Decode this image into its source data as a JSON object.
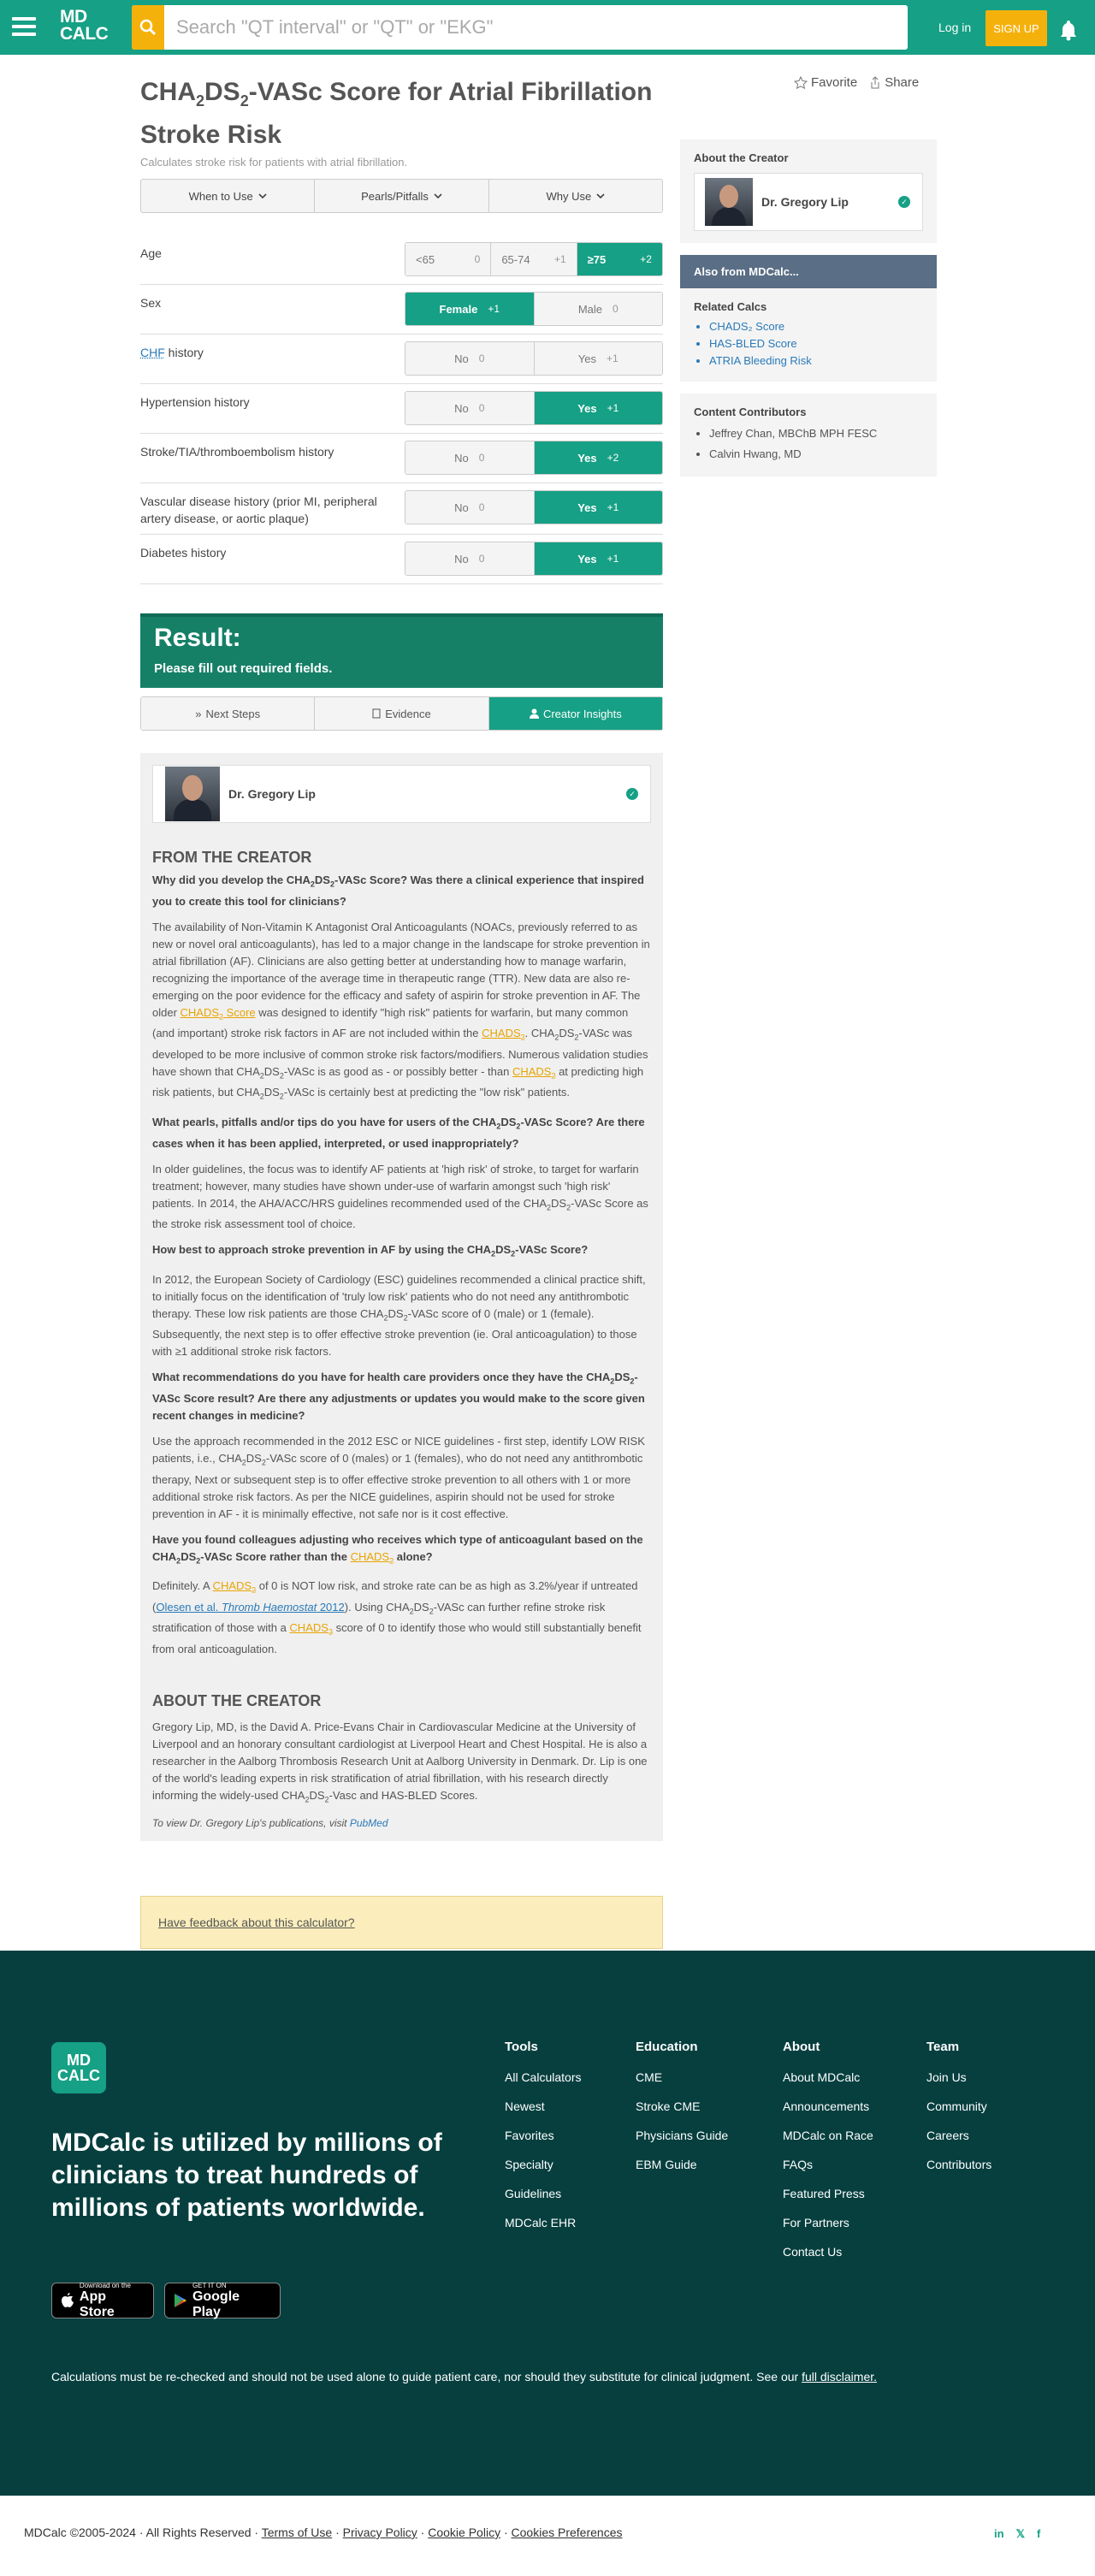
{
  "header": {
    "logo_line1": "MD",
    "logo_line2": "CALC",
    "search_placeholder": "Search \"QT interval\" or \"QT\" or \"EKG\"",
    "login": "Log in",
    "signup": "SIGN UP"
  },
  "page": {
    "title_a": "CHA",
    "title_sub1": "2",
    "title_b": "DS",
    "title_sub2": "2",
    "title_c": "-VASc Score for Atrial Fibrillation Stroke Risk",
    "subtitle": "Calculates stroke risk for patients with atrial fibrillation.",
    "favorite": "Favorite",
    "share": "Share",
    "tabs": [
      "When to Use",
      "Pearls/Pitfalls",
      "Why Use"
    ]
  },
  "inputs": [
    {
      "label": "Age",
      "options": [
        {
          "text": "<65",
          "pts": "0"
        },
        {
          "text": "65-74",
          "pts": "+1"
        },
        {
          "text": "≥75",
          "pts": "+2"
        }
      ],
      "selected": 2
    },
    {
      "label": "Sex",
      "options": [
        {
          "text": "Female",
          "pts": "+1"
        },
        {
          "text": "Male",
          "pts": "0"
        }
      ],
      "selected": 0
    },
    {
      "label_abbr": "CHF",
      "label": " history",
      "options": [
        {
          "text": "No",
          "pts": "0"
        },
        {
          "text": "Yes",
          "pts": "+1"
        }
      ],
      "selected": -1
    },
    {
      "label": "Hypertension history",
      "options": [
        {
          "text": "No",
          "pts": "0"
        },
        {
          "text": "Yes",
          "pts": "+1"
        }
      ],
      "selected": 1
    },
    {
      "label": "Stroke/TIA/thromboembolism history",
      "options": [
        {
          "text": "No",
          "pts": "0"
        },
        {
          "text": "Yes",
          "pts": "+2"
        }
      ],
      "selected": 1
    },
    {
      "label": "Vascular disease history (prior MI, peripheral artery disease, or aortic plaque)",
      "options": [
        {
          "text": "No",
          "pts": "0"
        },
        {
          "text": "Yes",
          "pts": "+1"
        }
      ],
      "selected": 1
    },
    {
      "label": "Diabetes history",
      "options": [
        {
          "text": "No",
          "pts": "0"
        },
        {
          "text": "Yes",
          "pts": "+1"
        }
      ],
      "selected": 1
    }
  ],
  "result": {
    "heading": "Result:",
    "message": "Please fill out required fields."
  },
  "subtabs": [
    "Next Steps",
    "Evidence",
    "Creator Insights"
  ],
  "creator": {
    "name": "Dr. Gregory Lip",
    "from_heading": "FROM THE CREATOR",
    "about_heading": "ABOUT THE CREATOR",
    "pubs_text": "To view Dr. Gregory Lip's publications, visit ",
    "pubs_link": "PubMed"
  },
  "feedback": "Have feedback about this calculator?",
  "sidebar": {
    "about_heading": "About the Creator",
    "creator_name": "Dr. Gregory Lip",
    "also_from": "Also from MDCalc...",
    "related_heading": "Related Calcs",
    "related": [
      "CHADS₂ Score",
      "HAS-BLED Score",
      "ATRIA Bleeding Risk"
    ],
    "contrib_heading": "Content Contributors",
    "contributors": [
      "Jeffrey Chan, MBChB MPH FESC",
      "Calvin Hwang, MD"
    ]
  },
  "footer": {
    "tagline": "MDCalc is utilized by millions of clinicians to treat hundreds of millions of patients worldwide.",
    "appstore_small": "Download on the",
    "appstore": "App Store",
    "gplay_small": "GET IT ON",
    "gplay": "Google Play",
    "cols": [
      {
        "heading": "Tools",
        "items": [
          "All Calculators",
          "Newest",
          "Favorites",
          "Specialty",
          "Guidelines",
          "MDCalc EHR"
        ]
      },
      {
        "heading": "Education",
        "items": [
          "CME",
          "Stroke CME",
          "Physicians Guide",
          "EBM Guide"
        ]
      },
      {
        "heading": "About",
        "items": [
          "About MDCalc",
          "Announcements",
          "MDCalc on Race",
          "FAQs",
          "Featured Press",
          "For Partners",
          "Contact Us"
        ]
      },
      {
        "heading": "Team",
        "items": [
          "Join Us",
          "Community",
          "Careers",
          "Contributors"
        ]
      }
    ],
    "disclaimer": "Calculations must be re-checked and should not be used alone to guide patient care, nor should they substitute for clinical judgment. See our ",
    "disclaimer_link": "full disclaimer.",
    "copyright": "MDCalc ©2005-2024  ·  All Rights Reserved  ·  ",
    "terms": "Terms of Use",
    "privacy": "Privacy Policy",
    "cookie": "Cookie Policy",
    "cookie_prefs": "Cookies Preferences",
    "social": [
      "in",
      "𝕏",
      "f"
    ]
  }
}
